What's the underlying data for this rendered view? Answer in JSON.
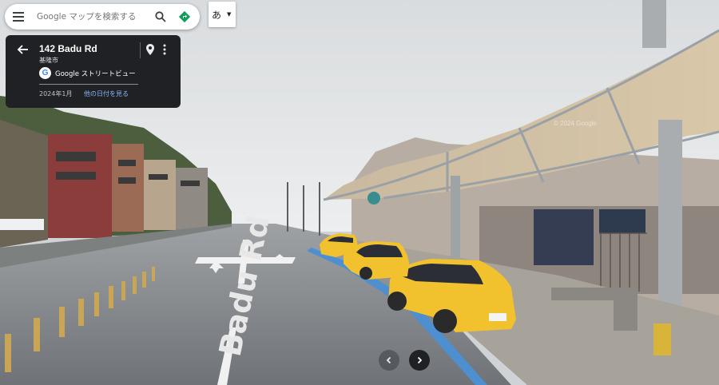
{
  "search": {
    "placeholder": "Google マップを検索する"
  },
  "ime": {
    "char": "あ"
  },
  "info_card": {
    "address": "142 Badu Rd",
    "city": "基隆市",
    "source": "Google ストリートビュー",
    "date": "2024年1月",
    "other_dates_link": "他の日付を見る"
  },
  "scene": {
    "road_text": "Badu Rd",
    "watermark": "© 2024 Google"
  },
  "icons": {
    "menu": "menu-icon",
    "search": "search-icon",
    "directions": "directions-icon",
    "back": "arrow-back-icon",
    "pin": "location-pin-icon",
    "more": "more-vert-icon",
    "prev": "chevron-left-icon",
    "next": "chevron-right-icon"
  },
  "colors": {
    "card_bg": "#202124",
    "link": "#8ab4f8",
    "directions": "#0f9d58",
    "taxi": "#f2c12e"
  }
}
